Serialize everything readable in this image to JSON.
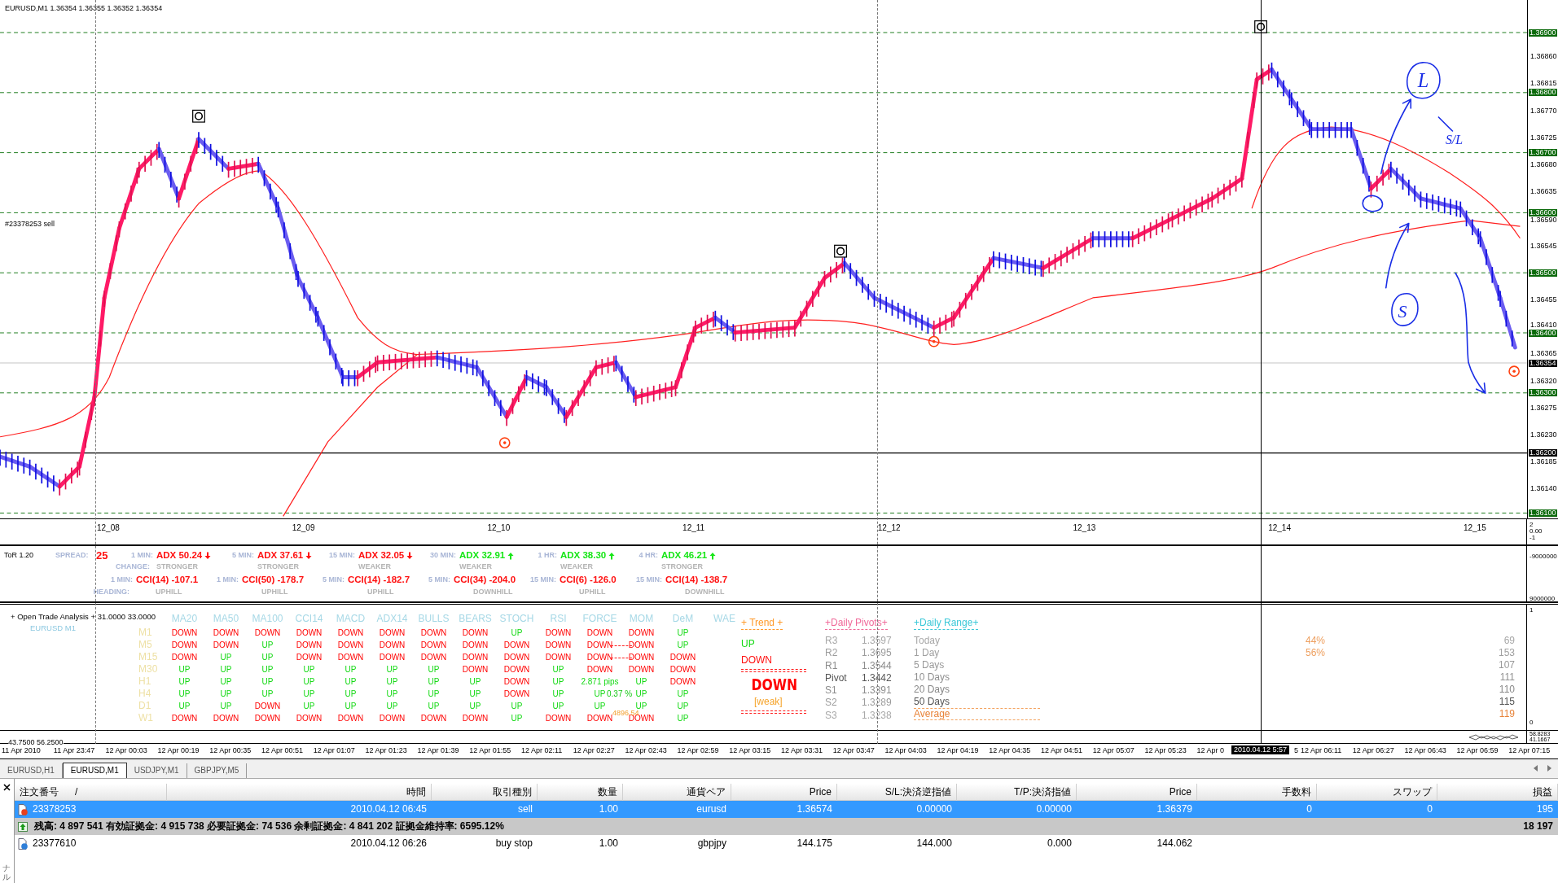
{
  "chart": {
    "symbol": "EURUSD,M1",
    "ohlc": "1.36354 1.36355 1.36352 1.36354",
    "order_label": "#23378253 sell",
    "price_ticks": [
      "1.36860",
      "1.36815",
      "1.36770",
      "1.36725",
      "1.36680",
      "1.36635",
      "1.36590",
      "1.36545",
      "1.36455",
      "1.36410",
      "1.36365",
      "1.36320",
      "1.36275",
      "1.36230",
      "1.36185",
      "1.36140"
    ],
    "price_levels": [
      {
        "label": "1.36900",
        "kind": "grid"
      },
      {
        "label": "1.36800",
        "kind": "grid"
      },
      {
        "label": "1.36700",
        "kind": "grid"
      },
      {
        "label": "1.36600",
        "kind": "grid"
      },
      {
        "label": "1.36500",
        "kind": "grid"
      },
      {
        "label": "1.36400",
        "kind": "grid"
      },
      {
        "label": "1.36300",
        "kind": "grid"
      },
      {
        "label": "1.36200",
        "kind": "line"
      },
      {
        "label": "1.36100",
        "kind": "grid"
      }
    ],
    "current_price": "1.36354",
    "annotations": [
      "L",
      "S/L",
      "S"
    ],
    "date_labels": [
      "12_08",
      "12_09",
      "12_10",
      "12_11",
      "12_12",
      "12_13",
      "12_14",
      "12_15"
    ],
    "date_axis_values": [
      "2",
      "0.00",
      "-1"
    ]
  },
  "tor": {
    "title": "ToR 1.20",
    "spread_label": "SPREAD:",
    "spread": "25",
    "change_label": "CHANGE:",
    "heading_label": "HEADING:",
    "adx": [
      {
        "period": "1 MIN:",
        "value": "ADX 50.24",
        "rising": false,
        "change": "STRONGER"
      },
      {
        "period": "5 MIN:",
        "value": "ADX 37.61",
        "rising": false,
        "change": "STRONGER"
      },
      {
        "period": "15 MIN:",
        "value": "ADX 32.05",
        "rising": false,
        "change": "WEAKER"
      },
      {
        "period": "30 MIN:",
        "value": "ADX 32.91",
        "rising": true,
        "change": "WEAKER"
      },
      {
        "period": "1 HR:",
        "value": "ADX 38.30",
        "rising": true,
        "change": "WEAKER"
      },
      {
        "period": "4 HR:",
        "value": "ADX 46.21",
        "rising": true,
        "change": "STRONGER"
      }
    ],
    "cci": [
      {
        "period": "1 MIN:",
        "value": "CCI(14) -107.1",
        "heading": "UPHILL"
      },
      {
        "period": "1 MIN:",
        "value": "CCI(50) -178.7",
        "heading": "UPHILL"
      },
      {
        "period": "5 MIN:",
        "value": "CCI(14) -182.7",
        "heading": "UPHILL"
      },
      {
        "period": "5 MIN:",
        "value": "CCI(34) -204.0",
        "heading": "DOWNHILL"
      },
      {
        "period": "15 MIN:",
        "value": "CCI(6) -126.0",
        "heading": "UPHILL"
      },
      {
        "period": "15 MIN:",
        "value": "CCI(14) -138.7",
        "heading": "DOWNHILL"
      }
    ],
    "axis": [
      "-9000000",
      "9000000"
    ]
  },
  "analysis": {
    "title": "+ Open Trade Analysis + 31.0000 33.0000",
    "symbol": "EURUSD  M1",
    "columns": [
      "MA20",
      "MA50",
      "MA100",
      "CCI14",
      "MACD",
      "ADX14",
      "BULLS",
      "BEARS",
      "STOCH",
      "RSI",
      "FORCE",
      "MOM",
      "DeM",
      "WAE"
    ],
    "rows": [
      {
        "label": "M1",
        "dashed": false,
        "cells": [
          {
            "text": "DOWN",
            "up": false
          },
          {
            "text": "DOWN",
            "up": false
          },
          {
            "text": "DOWN",
            "up": false
          },
          {
            "text": "DOWN",
            "up": false
          },
          {
            "text": "DOWN",
            "up": false
          },
          {
            "text": "DOWN",
            "up": false
          },
          {
            "text": "DOWN",
            "up": false
          },
          {
            "text": "DOWN",
            "up": false
          },
          {
            "text": "UP",
            "up": true
          },
          {
            "text": "DOWN",
            "up": false
          },
          {
            "text": "DOWN",
            "up": false
          },
          {
            "text": "DOWN",
            "up": false
          },
          {
            "text": "UP",
            "up": true
          }
        ]
      },
      {
        "label": "M5",
        "dashed": true,
        "cells": [
          {
            "text": "DOWN",
            "up": false
          },
          {
            "text": "DOWN",
            "up": false
          },
          {
            "text": "UP",
            "up": true
          },
          {
            "text": "DOWN",
            "up": false
          },
          {
            "text": "DOWN",
            "up": false
          },
          {
            "text": "DOWN",
            "up": false
          },
          {
            "text": "DOWN",
            "up": false
          },
          {
            "text": "DOWN",
            "up": false
          },
          {
            "text": "DOWN",
            "up": false
          },
          {
            "text": "DOWN",
            "up": false
          },
          {
            "text": "DOWN",
            "up": false
          },
          {
            "text": "DOWN",
            "up": false
          },
          {
            "text": "UP",
            "up": true
          }
        ]
      },
      {
        "label": "M15",
        "dashed": true,
        "cells": [
          {
            "text": "DOWN",
            "up": false
          },
          {
            "text": "UP",
            "up": true
          },
          {
            "text": "UP",
            "up": true
          },
          {
            "text": "DOWN",
            "up": false
          },
          {
            "text": "DOWN",
            "up": false
          },
          {
            "text": "DOWN",
            "up": false
          },
          {
            "text": "DOWN",
            "up": false
          },
          {
            "text": "DOWN",
            "up": false
          },
          {
            "text": "DOWN",
            "up": false
          },
          {
            "text": "DOWN",
            "up": false
          },
          {
            "text": "DOWN",
            "up": false
          },
          {
            "text": "DOWN",
            "up": false
          },
          {
            "text": "DOWN",
            "up": false
          }
        ]
      },
      {
        "label": "M30",
        "dashed": false,
        "cells": [
          {
            "text": "UP",
            "up": true
          },
          {
            "text": "UP",
            "up": true
          },
          {
            "text": "UP",
            "up": true
          },
          {
            "text": "UP",
            "up": true
          },
          {
            "text": "UP",
            "up": true
          },
          {
            "text": "UP",
            "up": true
          },
          {
            "text": "UP",
            "up": true
          },
          {
            "text": "DOWN",
            "up": false
          },
          {
            "text": "DOWN",
            "up": false
          },
          {
            "text": "UP",
            "up": true
          },
          {
            "text": "DOWN",
            "up": false
          },
          {
            "text": "DOWN",
            "up": false
          },
          {
            "text": "DOWN",
            "up": false
          }
        ]
      },
      {
        "label": "H1",
        "dashed": false,
        "cells": [
          {
            "text": "UP",
            "up": true
          },
          {
            "text": "UP",
            "up": true
          },
          {
            "text": "UP",
            "up": true
          },
          {
            "text": "UP",
            "up": true
          },
          {
            "text": "UP",
            "up": true
          },
          {
            "text": "UP",
            "up": true
          },
          {
            "text": "UP",
            "up": true
          },
          {
            "text": "UP",
            "up": true
          },
          {
            "text": "DOWN",
            "up": false
          },
          {
            "text": "UP",
            "up": true
          },
          {
            "text": "2.871 pips",
            "up": true
          },
          {
            "text": "UP",
            "up": true
          },
          {
            "text": "DOWN",
            "up": false
          }
        ]
      },
      {
        "label": "H4",
        "dashed": false,
        "cells": [
          {
            "text": "UP",
            "up": true
          },
          {
            "text": "UP",
            "up": true
          },
          {
            "text": "UP",
            "up": true
          },
          {
            "text": "UP",
            "up": true
          },
          {
            "text": "UP",
            "up": true
          },
          {
            "text": "UP",
            "up": true
          },
          {
            "text": "UP",
            "up": true
          },
          {
            "text": "UP",
            "up": true
          },
          {
            "text": "DOWN",
            "up": false
          },
          {
            "text": "UP",
            "up": true
          },
          {
            "text": "UP",
            "up": true
          },
          {
            "text": "UP",
            "up": true
          },
          {
            "text": "UP",
            "up": true
          }
        ]
      },
      {
        "label": "D1",
        "dashed": false,
        "cells": [
          {
            "text": "UP",
            "up": true
          },
          {
            "text": "UP",
            "up": true
          },
          {
            "text": "DOWN",
            "up": false
          },
          {
            "text": "UP",
            "up": true
          },
          {
            "text": "UP",
            "up": true
          },
          {
            "text": "UP",
            "up": true
          },
          {
            "text": "UP",
            "up": true
          },
          {
            "text": "UP",
            "up": true
          },
          {
            "text": "UP",
            "up": true
          },
          {
            "text": "UP",
            "up": true
          },
          {
            "text": "UP",
            "up": true
          },
          {
            "text": "UP",
            "up": true
          },
          {
            "text": "UP",
            "up": true
          }
        ]
      },
      {
        "label": "W1",
        "dashed": false,
        "cells": [
          {
            "text": "DOWN",
            "up": false
          },
          {
            "text": "DOWN",
            "up": false
          },
          {
            "text": "DOWN",
            "up": false
          },
          {
            "text": "DOWN",
            "up": false
          },
          {
            "text": "DOWN",
            "up": false
          },
          {
            "text": "DOWN",
            "up": false
          },
          {
            "text": "DOWN",
            "up": false
          },
          {
            "text": "DOWN",
            "up": false
          },
          {
            "text": "UP",
            "up": true
          },
          {
            "text": "DOWN",
            "up": false
          },
          {
            "text": "DOWN",
            "up": false
          },
          {
            "text": "DOWN",
            "up": false
          },
          {
            "text": "UP",
            "up": true
          }
        ]
      }
    ],
    "notes": [
      {
        "text": "0.37 %",
        "kind": "percent"
      },
      {
        "text": "4896.54",
        "kind": "price"
      }
    ],
    "trend": {
      "title": "+  Trend  +",
      "up_label": "UP",
      "down_label": "DOWN",
      "signal": "DOWN",
      "rising": false,
      "strength": "[weak]"
    },
    "pivots": {
      "title": "+Daily Pivots+",
      "levels": [
        {
          "name": "R3",
          "value": "1.3597",
          "color": "#a8a8a8"
        },
        {
          "name": "R2",
          "value": "1.3695",
          "color": "#9c9c9c"
        },
        {
          "name": "R1",
          "value": "1.3544",
          "color": "#8c8c8c"
        },
        {
          "name": "Pivot",
          "value": "1.3442",
          "color": "#555555"
        },
        {
          "name": "S1",
          "value": "1.3391",
          "color": "#8c8c8c"
        },
        {
          "name": "S2",
          "value": "1.3289",
          "color": "#9c9c9c"
        },
        {
          "name": "S3",
          "value": "1.3238",
          "color": "#a8a8a8"
        }
      ]
    },
    "range": {
      "title": "+Daily Range+",
      "percents": [
        "44%",
        "56%"
      ],
      "rows": [
        {
          "label": "Today",
          "value": "69",
          "kind": "period",
          "color": "#a8a8a8"
        },
        {
          "label": "1 Day",
          "value": "153",
          "kind": "period",
          "color": "#a0a0a0"
        },
        {
          "label": "5 Days",
          "value": "107",
          "kind": "period",
          "color": "#999999"
        },
        {
          "label": "10 Days",
          "value": "111",
          "kind": "period",
          "color": "#909090"
        },
        {
          "label": "20 Days",
          "value": "110",
          "kind": "period",
          "color": "#888888"
        },
        {
          "label": "50 Days",
          "value": "115",
          "kind": "period",
          "color": "#555555"
        },
        {
          "label": "Average",
          "value": "119",
          "kind": "average",
          "color": "#e8843a"
        }
      ]
    },
    "axis": [
      "1",
      "0"
    ]
  },
  "oscillator": {
    "values": "43.7500 56.2500",
    "axis": [
      "58.8283",
      "41.1667"
    ]
  },
  "time_axis": {
    "labels": [
      "11 Apr 2010",
      "11 Apr 23:47",
      "12 Apr 00:03",
      "12 Apr 00:19",
      "12 Apr 00:35",
      "12 Apr 00:51",
      "12 Apr 01:07",
      "12 Apr 01:23",
      "12 Apr 01:39",
      "12 Apr 01:55",
      "12 Apr 02:11",
      "12 Apr 02:27",
      "12 Apr 02:43",
      "12 Apr 02:59",
      "12 Apr 03:15",
      "12 Apr 03:31",
      "12 Apr 03:47",
      "12 Apr 04:03",
      "12 Apr 04:19",
      "12 Apr 04:35",
      "12 Apr 04:51",
      "12 Apr 05:07",
      "12 Apr 05:23",
      "12 Apr 0"
    ],
    "cursor": "2010.04.12 5:57",
    "cursor_tail": "5",
    "labels_after": [
      "12 Apr 06:11",
      "12 Apr 06:27",
      "12 Apr 06:43",
      "12 Apr 06:59",
      "12 Apr 07:15"
    ]
  },
  "tabs": [
    {
      "label": "EURUSD,H1",
      "selected": false
    },
    {
      "label": "EURUSD,M1",
      "selected": true
    },
    {
      "label": "USDJPY,M1",
      "selected": false
    },
    {
      "label": "GBPJPY,M5",
      "selected": false
    }
  ],
  "terminal": {
    "side_label": "ナル",
    "sort_mark": "/",
    "columns": [
      "注文番号",
      "時間",
      "取引種別",
      "数量",
      "通貨ペア",
      "Price",
      "S/L:決済逆指値",
      "T/P:決済指値",
      "Price",
      "手数料",
      "スワップ",
      "損益"
    ],
    "rows": [
      {
        "kind": "order",
        "selected": true,
        "color": "#e8401c",
        "cells": [
          "23378253",
          "2010.04.12 06:45",
          "sell",
          "1.00",
          "eurusd",
          "1.36574",
          "0.00000",
          "0.00000",
          "1.36379",
          "0",
          "0",
          "195"
        ]
      },
      {
        "kind": "balance",
        "text": "残高: 4 897 541  有効証拠金: 4 915 738  必要証拠金: 74 536  余剰証拠金: 4 841 202  証拠金維持率: 6595.12%",
        "total": "18 197"
      },
      {
        "kind": "order",
        "selected": false,
        "color": "#2f7fd8",
        "cells": [
          "23377610",
          "2010.04.12 06:26",
          "buy stop",
          "1.00",
          "gbpjpy",
          "144.175",
          "144.000",
          "0.000",
          "144.062",
          "",
          "",
          ""
        ]
      }
    ]
  }
}
